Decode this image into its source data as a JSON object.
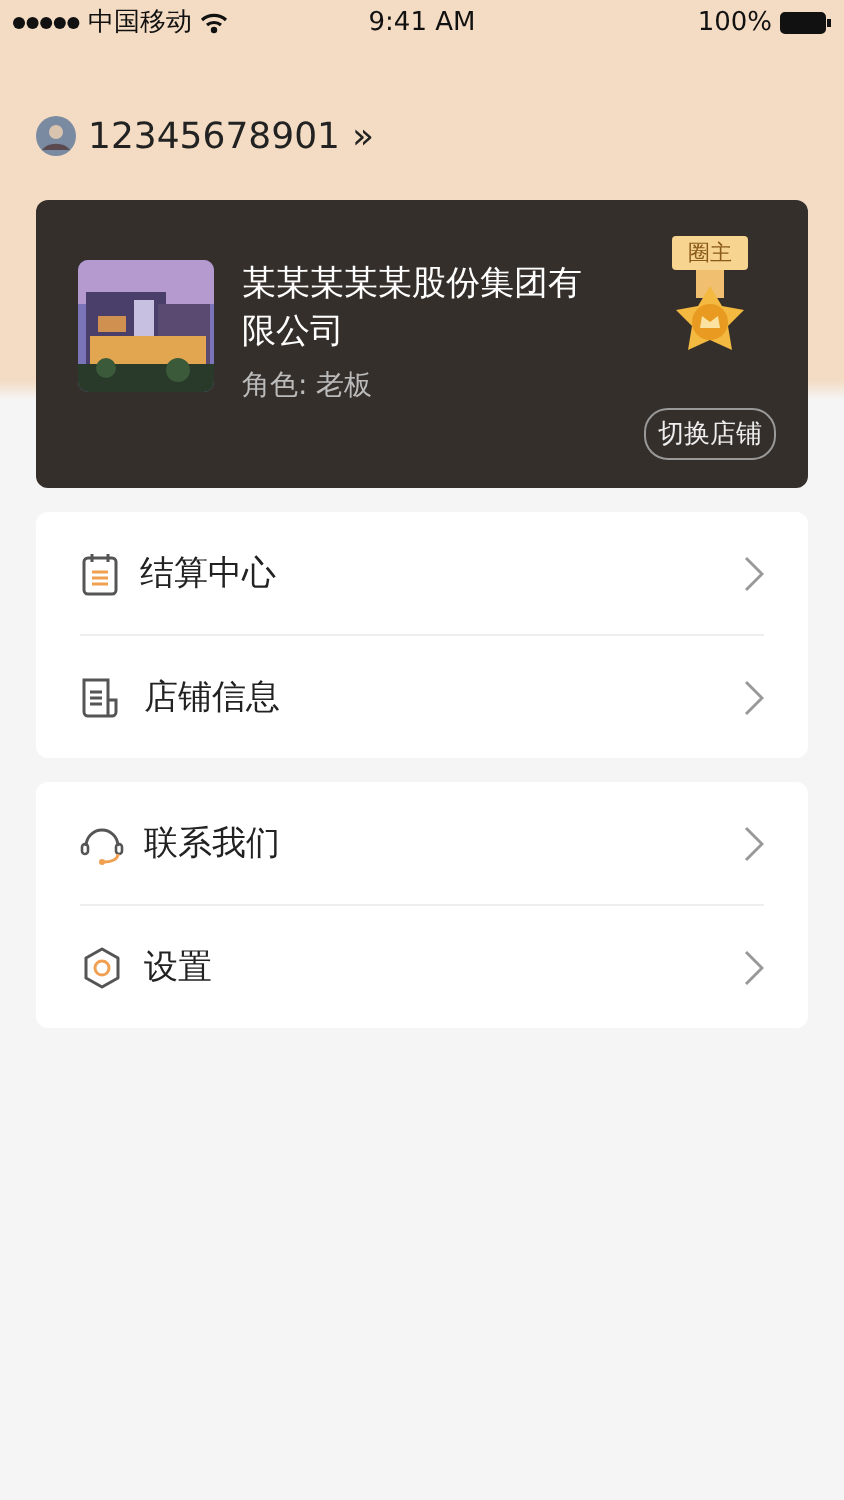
{
  "status_bar": {
    "carrier": "中国移动",
    "time": "9:41 AM",
    "battery": "100%"
  },
  "user": {
    "phone": "12345678901",
    "chevron": "»"
  },
  "company_card": {
    "name": "某某某某某股份集团有限公司",
    "role": "角色: 老板",
    "badge": "圈主",
    "switch_button": "切换店铺"
  },
  "menu_groups": [
    {
      "items": [
        {
          "label": "结算中心"
        },
        {
          "label": "店铺信息"
        }
      ]
    },
    {
      "items": [
        {
          "label": "联系我们"
        },
        {
          "label": "设置"
        }
      ]
    }
  ]
}
